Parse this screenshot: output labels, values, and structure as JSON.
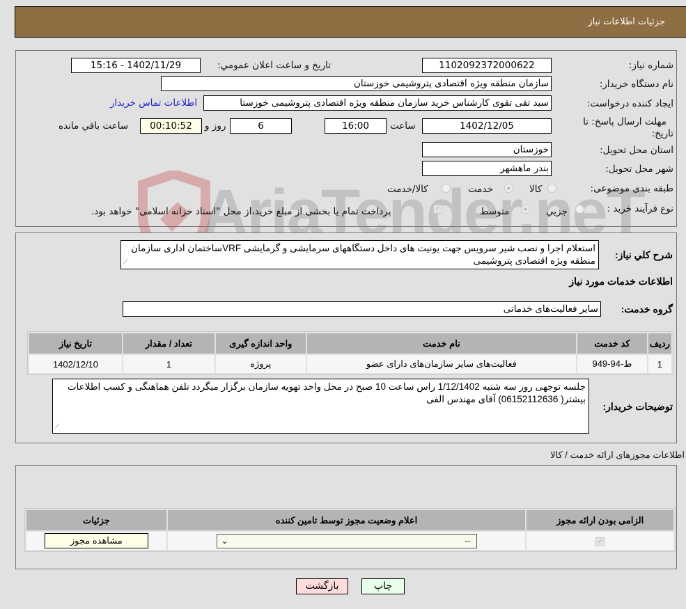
{
  "header": {
    "title": "جزئیات اطلاعات نیاز"
  },
  "need_info": {
    "need_number_label": "شماره نیاز:",
    "need_number": "1102092372000622",
    "announce_label": "تاریخ و ساعت اعلان عمومي:",
    "announce_value": "1402/11/29 - 15:16",
    "buyer_org_label": "نام دستگاه خریدار:",
    "buyer_org": "سازمان منطقه ویژه اقتصادی پتروشیمی خوزستان",
    "creator_label": "ایجاد کننده درخواست:",
    "creator": "سید تقی تقوی کارشناس خرید سازمان منطقه ویژه اقتصادی پتروشیمی خوزستا",
    "buyer_contact_link": "اطلاعات تماس خریدار",
    "deadline_label_1": "مهلت ارسال پاسخ: تا",
    "deadline_label_2": "تاریخ:",
    "deadline_date": "1402/12/05",
    "time_label": "ساعت",
    "deadline_time": "16:00",
    "days_value": "6",
    "days_label": "روز و",
    "remaining_time": "00:10:52",
    "remaining_label": "ساعت باقي مانده",
    "province_label": "استان محل تحویل:",
    "province": "خوزستان",
    "city_label": "شهر محل تحویل:",
    "city": "بندر ماهشهر",
    "category_label": "طبقه بندی موضوعی:",
    "category_options": [
      "کالا",
      "خدمت",
      "کالا/خدمت"
    ],
    "category_selected": "خدمت",
    "process_label": "نوع فرآیند خرید :",
    "process_options": [
      "جزيي",
      "متوسط"
    ],
    "process_selected": "متوسط",
    "treasury_note": "پرداخت تمام یا بخشی از مبلغ خرید،از محل \"اسناد خزانه اسلامی\" خواهد بود."
  },
  "description": {
    "label": "شرح كلي نياز:",
    "text": "استعلام اجرا و نصب شیر سرویس جهت یونیت های داخل دستگاههای سرمایشی و گرمایشی VRFساختمان اداری سازمان منطقه ویژه اقتصادی پتروشیمی"
  },
  "services": {
    "section_title": "اطلاعات خدمات مورد نیاز",
    "group_label": "گروه خدمت:",
    "group_value": "سایر فعالیت‌های خدماتی",
    "columns": [
      "ردیف",
      "کد خدمت",
      "نام خدمت",
      "واحد اندازه گیری",
      "تعداد / مقدار",
      "تاریخ نیاز"
    ],
    "rows": [
      [
        "1",
        "ط-94-949",
        "فعالیت‌های سایر سازمان‌های دارای عضو",
        "پروژه",
        "1",
        "1402/12/10"
      ]
    ]
  },
  "buyer_notes": {
    "label": "توضیحات خریدار:",
    "text": "جلسه توجهی  روز سه شنبه 1/12/1402 راس ساعت 10 صبح در محل واحد تهویه سازمان برگزار میگردد تلفن هماهنگی و کسب اطلاعات بیشتر( 06152112636) آقای مهندس الفی"
  },
  "licenses": {
    "section_title": "اطلاعات مجوزهای ارائه خدمت / کالا",
    "columns": [
      "الزامی بودن ارائه مجوز",
      "اعلام وضعیت مجوز توسط تامین کننده",
      "جزئیات"
    ],
    "row": {
      "required_checked": true,
      "status_select_value": "--",
      "details_button": "مشاهده مجوز"
    }
  },
  "footer": {
    "print_button": "چاپ",
    "back_button": "بازگشت"
  },
  "watermark": {
    "text": "AriaTender.neT"
  }
}
